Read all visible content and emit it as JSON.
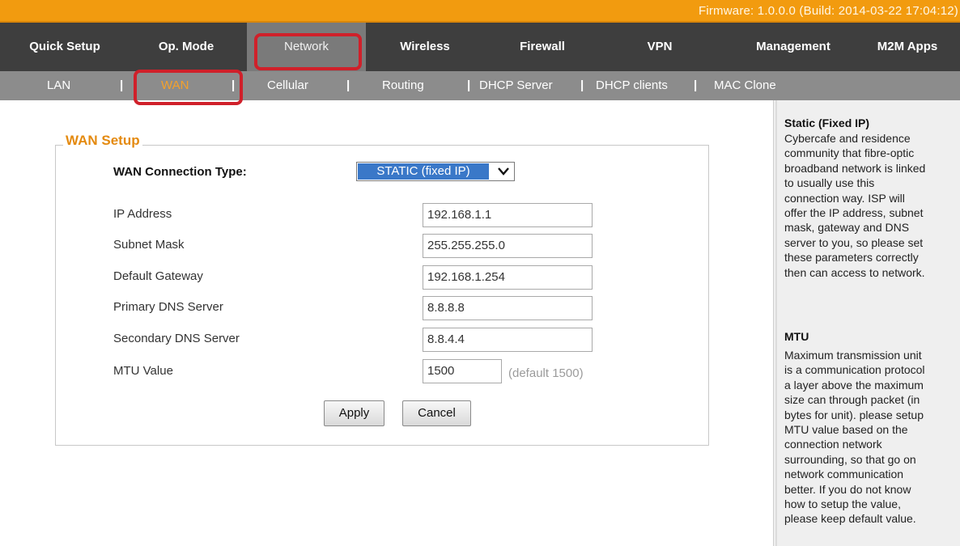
{
  "firmware": "Firmware: 1.0.0.0 (Build: 2014-03-22 17:04:12)",
  "nav": {
    "quick_setup": "Quick Setup",
    "op_mode": "Op. Mode",
    "network": "Network",
    "wireless": "Wireless",
    "firewall": "Firewall",
    "vpn": "VPN",
    "management": "Management",
    "m2m_apps": "M2M Apps"
  },
  "subnav": {
    "lan": "LAN",
    "wan": "WAN",
    "cellular": "Cellular",
    "routing": "Routing",
    "dhcp_server": "DHCP Server",
    "dhcp_clients": "DHCP clients",
    "mac_clone": "MAC Clone",
    "separator": "|"
  },
  "wan_setup": {
    "legend": "WAN Setup",
    "connection_type_label": "WAN Connection Type:",
    "connection_type_value": "STATIC (fixed IP)",
    "ip_address_label": "IP Address",
    "ip_address": "192.168.1.1",
    "subnet_mask_label": "Subnet Mask",
    "subnet_mask": "255.255.255.0",
    "gateway_label": "Default Gateway",
    "gateway": "192.168.1.254",
    "primary_dns_label": "Primary DNS Server",
    "primary_dns": "8.8.8.8",
    "secondary_dns_label": "Secondary DNS Server",
    "secondary_dns": "8.8.4.4",
    "mtu_label": "MTU Value",
    "mtu": "1500",
    "mtu_hint": "(default 1500)",
    "apply": "Apply",
    "cancel": "Cancel"
  },
  "help": {
    "static_title": "Static (Fixed IP)",
    "static_lines": [
      "Cybercafe and residence",
      "community that fibre-optic",
      "broadband network is linked",
      "to usually use this",
      "connection way. ISP will",
      "offer the IP address, subnet",
      "mask, gateway and DNS",
      "server to you, so please set",
      "these parameters correctly",
      "then can access to network."
    ],
    "mtu_title": "MTU",
    "mtu_lines": [
      "Maximum transmission unit",
      "is a communication protocol",
      "a layer above the maximum",
      "size can through packet (in",
      "bytes for unit). please setup",
      "MTU value based on the",
      "connection network",
      "surrounding, so that go on",
      "network communication",
      "better. If you do not know",
      "how to setup the value,",
      "please keep default value."
    ]
  },
  "colors": {
    "firmware_bar": "#f29b0f",
    "nav_bg": "#3e3e3e",
    "subnav_bg": "#8c8c8c",
    "highlight_box": "#d0202a",
    "legend_text": "#e48a10",
    "select_bg": "#3a78c8"
  }
}
